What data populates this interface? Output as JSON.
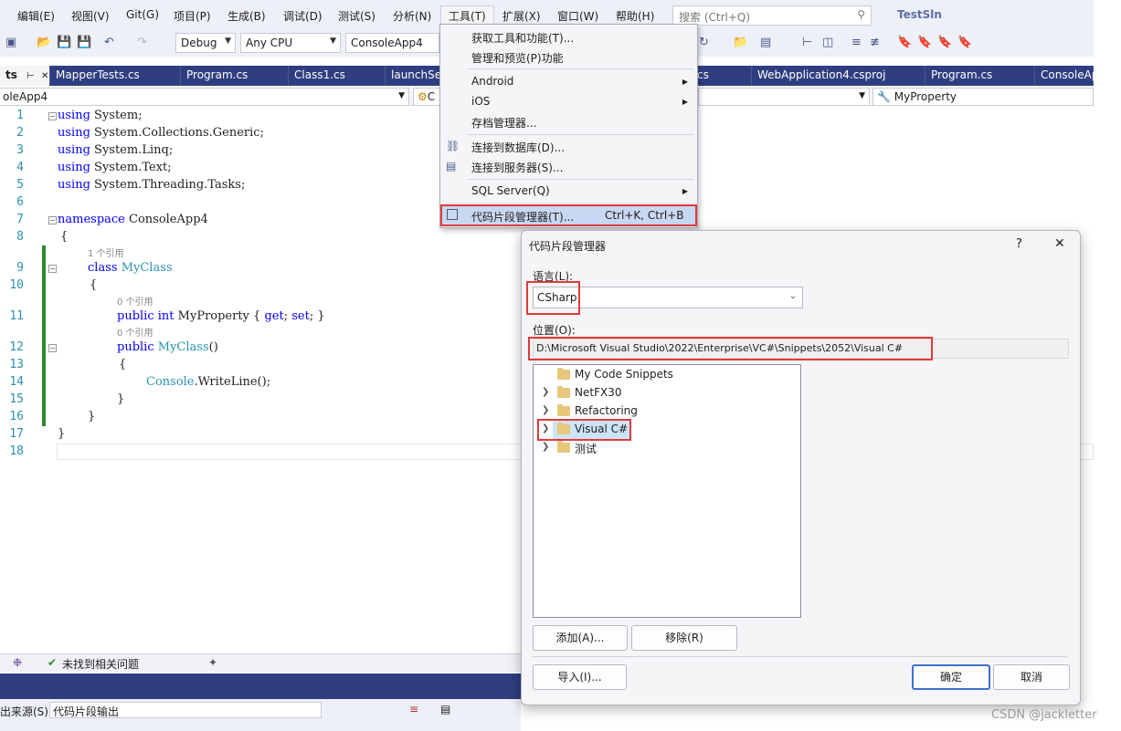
{
  "menubar": {
    "items": [
      "编辑(E)",
      "视图(V)",
      "Git(G)",
      "项目(P)",
      "生成(B)",
      "调试(D)",
      "测试(S)",
      "分析(N)",
      "工具(T)",
      "扩展(X)",
      "窗口(W)",
      "帮助(H)"
    ],
    "search_placeholder": "搜索 (Ctrl+Q)",
    "solution_name": "TestSln"
  },
  "toolbar": {
    "config": "Debug",
    "platform": "Any CPU",
    "project": "ConsoleApp4"
  },
  "tabs": [
    "ts",
    "MapperTests.cs",
    "Program.cs",
    "Class1.cs",
    "launchSet",
    "cs",
    "WebApplication4.csproj",
    "Program.cs",
    "ConsoleAp"
  ],
  "navbar": {
    "project": "oleApp4",
    "class_prefix": "C",
    "member": "MyProperty"
  },
  "editor": {
    "line_numbers": [
      "1",
      "2",
      "3",
      "4",
      "5",
      "6",
      "7",
      "8",
      "9",
      "10",
      "11",
      "12",
      "13",
      "14",
      "15",
      "16",
      "17",
      "18"
    ],
    "refs": {
      "one_ref": "1 个引用",
      "zero_ref": "0 个引用"
    },
    "kw": {
      "using": "using",
      "namespace": "namespace",
      "class": "class",
      "public": "public",
      "int": "int",
      "get": "get",
      "set": "set"
    },
    "text": {
      "l1": " System;",
      "l2": " System.Collections.Generic;",
      "l3": " System.Linq;",
      "l4": " System.Text;",
      "l5": " System.Threading.Tasks;",
      "ns": " ConsoleApp4",
      "open": "{",
      "close": "}",
      "classname": "MyClass",
      "prop": " MyProperty { ",
      "semi": "; ",
      "semi_close": "; }",
      "ctor_parens": "()",
      "console": "Console",
      "writeline": ".WriteLine();"
    }
  },
  "tools_menu": {
    "items": {
      "get_tools": "获取工具和功能(T)...",
      "manage_preview": "管理和预览(P)功能",
      "android": "Android",
      "ios": "iOS",
      "archive": "存档管理器...",
      "connect_db": "连接到数据库(D)...",
      "connect_server": "连接到服务器(S)...",
      "sql_server": "SQL Server(Q)",
      "snippets": "代码片段管理器(T)...",
      "snippets_shortcut": "Ctrl+K, Ctrl+B"
    }
  },
  "dialog": {
    "title": "代码片段管理器",
    "help": "?",
    "close": "✕",
    "language_label": "语言(L):",
    "language_value": "CSharp",
    "location_label": "位置(O):",
    "location_value": "D:\\Microsoft Visual Studio\\2022\\Enterprise\\VC#\\Snippets\\2052\\Visual C#",
    "tree": [
      "My Code Snippets",
      "NetFX30",
      "Refactoring",
      "Visual C#",
      "测试"
    ],
    "buttons": {
      "add": "添加(A)...",
      "remove": "移除(R)",
      "import": "导入(I)...",
      "ok": "确定",
      "cancel": "取消"
    }
  },
  "status": {
    "issues": "未找到相关问题",
    "output_source_label": "出来源(S):",
    "output_source_value": "代码片段输出"
  },
  "watermark": "CSDN @jackletter",
  "colors": {
    "accent": "#2f3e80",
    "highlight_border": "#e03a3a",
    "keyword": "#0000ff",
    "type": "#2b91af"
  }
}
